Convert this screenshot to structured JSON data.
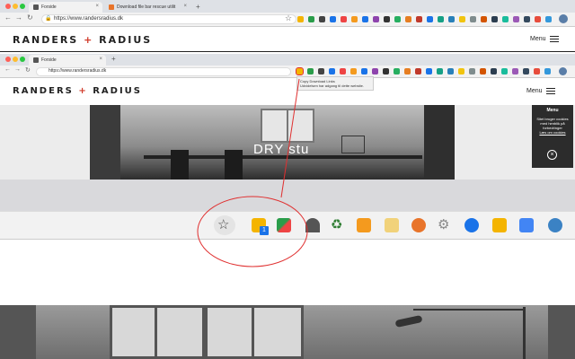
{
  "browser": {
    "tabs": [
      {
        "label": "Forside",
        "active": true
      },
      {
        "label": "Download file bar rescue utilit",
        "active": false
      }
    ],
    "new_tab_symbol": "+",
    "url": "https://www.randersradius.dk"
  },
  "site": {
    "logo_left": "RANDERS",
    "logo_plus": "+",
    "logo_right": "RADIUS",
    "menu_label": "Menu"
  },
  "inner": {
    "tab_label": "Forside",
    "url": "https://www.randersradius.dk",
    "tooltip_line1": "Copy Download Links",
    "tooltip_line2": "Udvidelsen har adgang til dette website.",
    "hero_title": "DRY stu",
    "popover": {
      "title": "Menu",
      "text": "Sitet bruger cookies med henblik på forbedringer",
      "link": "Læs om cookies",
      "close_symbol": "×"
    }
  },
  "extension_badge": "1",
  "colors": {
    "accent": "#d13b2a",
    "annotation": "#e03030"
  }
}
